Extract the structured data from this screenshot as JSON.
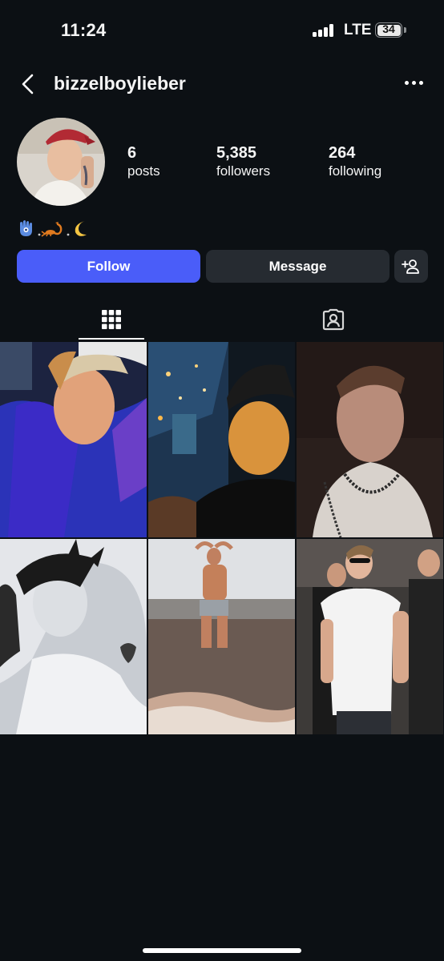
{
  "status_bar": {
    "time": "11:24",
    "network": "LTE",
    "battery": "34",
    "battery_level": 0.34
  },
  "header": {
    "username": "bizzelboylieber",
    "back_icon": "chevron-left-icon",
    "more_icon": "more-horizontal-icon"
  },
  "profile": {
    "avatar_description": "profile-photo",
    "stats": [
      {
        "value": "6",
        "label": "posts"
      },
      {
        "value": "5,385",
        "label": "followers"
      },
      {
        "value": "264",
        "label": "following"
      }
    ],
    "bio_emojis": [
      "hamsa-icon",
      "scorpion-icon",
      "crescent-moon-icon"
    ],
    "bio_separators": [
      "·",
      "·"
    ]
  },
  "actions": {
    "follow_label": "Follow",
    "message_label": "Message",
    "add_user_icon": "add-user-icon",
    "follow_color": "#4a5df9"
  },
  "tabs": [
    {
      "icon": "grid-icon",
      "active": true
    },
    {
      "icon": "tagged-user-icon",
      "active": false
    }
  ],
  "posts": [
    {
      "description": "man in purple hoodie and white cap"
    },
    {
      "description": "selfie in black cap above city at night"
    },
    {
      "description": "close-up selfie with beaded necklace"
    },
    {
      "description": "black and white photo in cap with tattoo"
    },
    {
      "description": "shirtless man standing in the sea"
    },
    {
      "description": "man in white t-shirt with sunglasses in crowd"
    }
  ]
}
